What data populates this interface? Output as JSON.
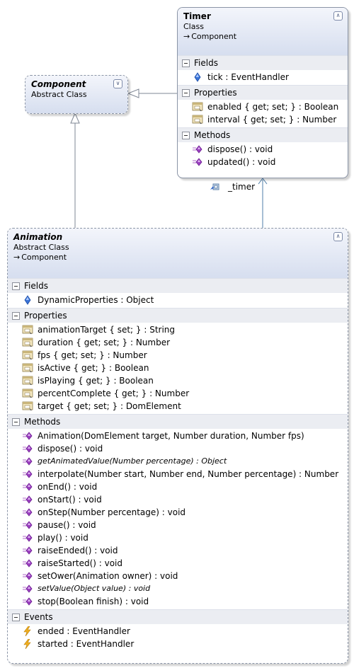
{
  "timer": {
    "name": "Timer",
    "stereotype": "Class",
    "base": "Component",
    "sections": [
      {
        "title": "Fields",
        "members": [
          {
            "kind": "field",
            "text": "tick : EventHandler"
          }
        ]
      },
      {
        "title": "Properties",
        "members": [
          {
            "kind": "property",
            "text": "enabled { get; set; } : Boolean"
          },
          {
            "kind": "property",
            "text": "interval { get; set; } : Number"
          }
        ]
      },
      {
        "title": "Methods",
        "members": [
          {
            "kind": "method",
            "text": "dispose() : void"
          },
          {
            "kind": "method",
            "text": "updated() : void"
          }
        ]
      }
    ]
  },
  "component": {
    "name": "Component",
    "stereotype": "Abstract Class"
  },
  "association": {
    "label": "_timer"
  },
  "animation": {
    "name": "Animation",
    "stereotype": "Abstract Class",
    "base": "Component",
    "sections": [
      {
        "title": "Fields",
        "members": [
          {
            "kind": "field",
            "text": "DynamicProperties : Object"
          }
        ]
      },
      {
        "title": "Properties",
        "members": [
          {
            "kind": "property",
            "text": "animationTarget { set; } : String"
          },
          {
            "kind": "property",
            "text": "duration { get; set; } : Number"
          },
          {
            "kind": "property",
            "text": "fps { get; set; } : Number"
          },
          {
            "kind": "property",
            "text": "isActive { get; } : Boolean"
          },
          {
            "kind": "property",
            "text": "isPlaying { get; } : Boolean"
          },
          {
            "kind": "property",
            "text": "percentComplete { get; } : Number"
          },
          {
            "kind": "property",
            "text": "target { get; set; } : DomElement"
          }
        ]
      },
      {
        "title": "Methods",
        "members": [
          {
            "kind": "method",
            "text": "Animation(DomElement target, Number duration, Number fps)"
          },
          {
            "kind": "method",
            "text": "dispose() : void"
          },
          {
            "kind": "method",
            "text": "getAnimatedValue(Number percentage) : Object",
            "italic": true
          },
          {
            "kind": "method",
            "text": "interpolate(Number start, Number end, Number percentage) : Number"
          },
          {
            "kind": "method",
            "text": "onEnd() : void"
          },
          {
            "kind": "method",
            "text": "onStart() : void"
          },
          {
            "kind": "method",
            "text": "onStep(Number percentage) : void"
          },
          {
            "kind": "method",
            "text": "pause() : void"
          },
          {
            "kind": "method",
            "text": "play() : void"
          },
          {
            "kind": "method",
            "text": "raiseEnded() : void"
          },
          {
            "kind": "method",
            "text": "raiseStarted() : void"
          },
          {
            "kind": "method",
            "text": "setOwer(Animation owner) : void"
          },
          {
            "kind": "method",
            "text": "setValue(Object value) : void",
            "italic": true
          },
          {
            "kind": "method",
            "text": "stop(Boolean finish) : void"
          }
        ]
      },
      {
        "title": "Events",
        "members": [
          {
            "kind": "event",
            "text": "ended : EventHandler"
          },
          {
            "kind": "event",
            "text": "started : EventHandler"
          }
        ]
      }
    ]
  }
}
